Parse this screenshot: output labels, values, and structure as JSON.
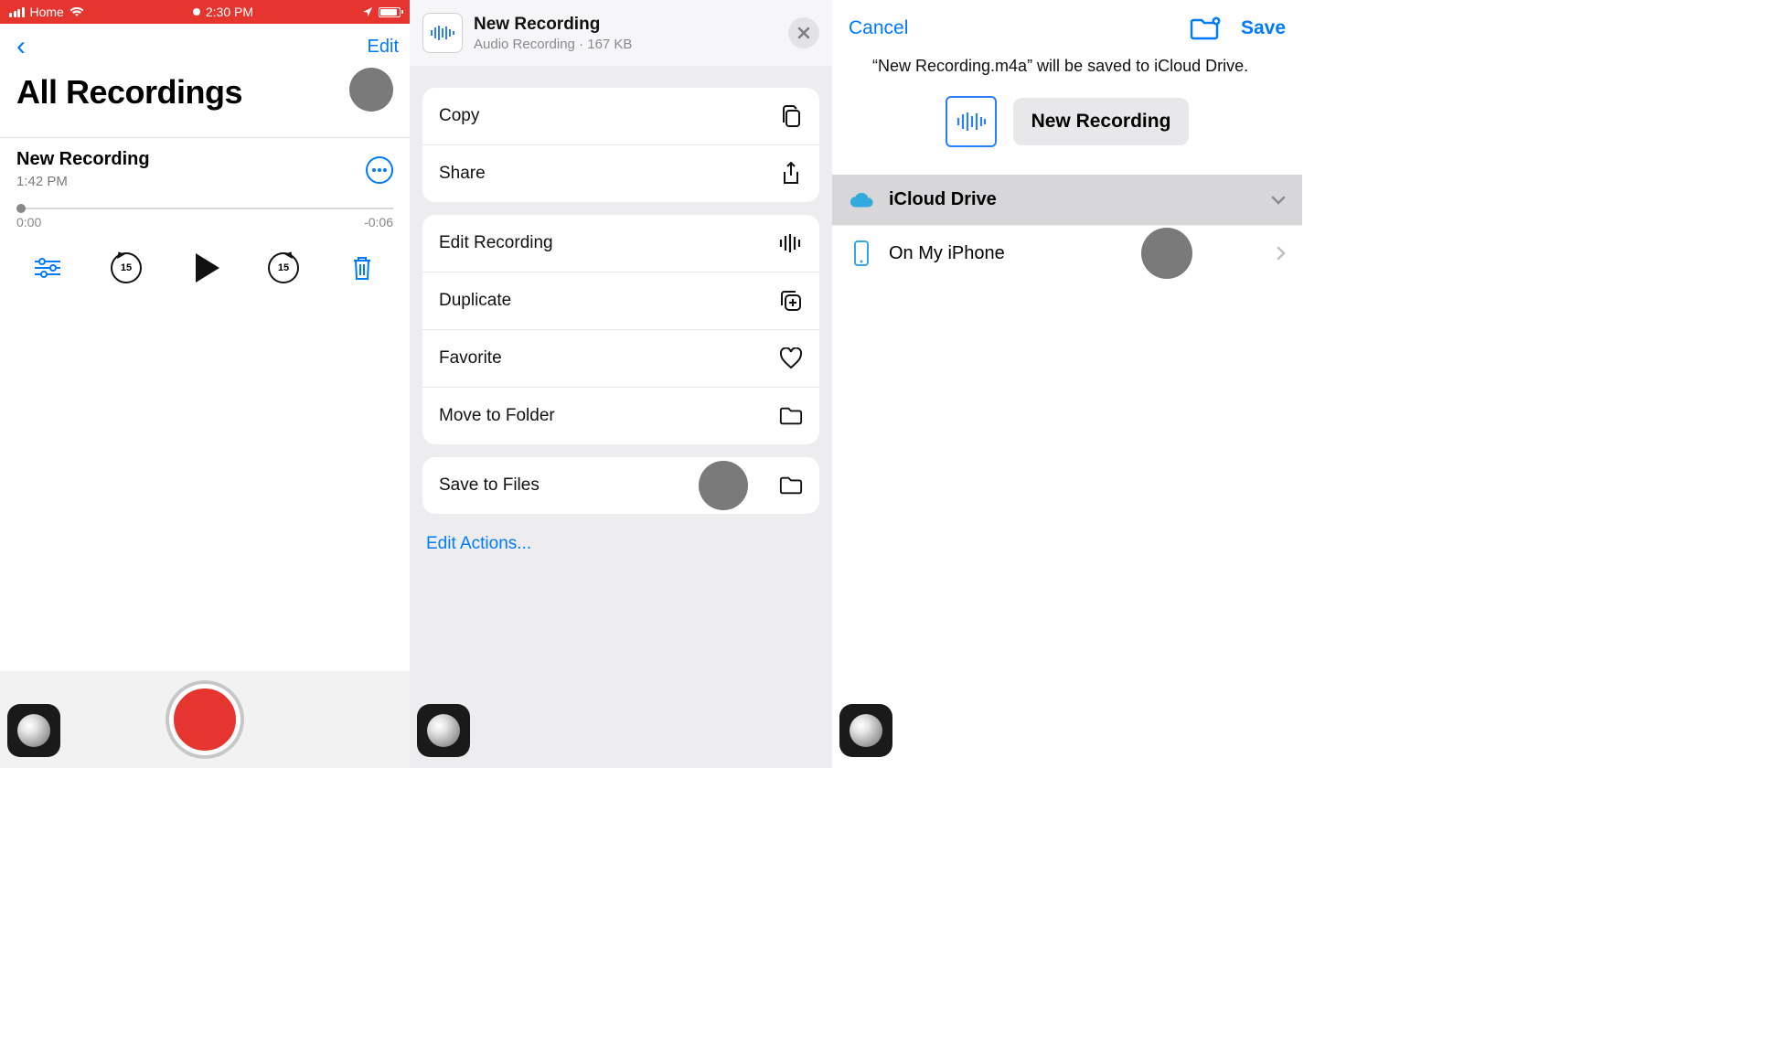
{
  "panel1": {
    "status": {
      "carrier": "Home",
      "time": "2:30 PM"
    },
    "edit": "Edit",
    "title": "All Recordings",
    "recording": {
      "name": "New Recording",
      "time": "1:42 PM",
      "elapsed": "0:00",
      "remaining": "-0:06",
      "skip": "15"
    }
  },
  "panel2": {
    "header": {
      "title": "New Recording",
      "subtitle": "Audio Recording · 167 KB"
    },
    "actions": {
      "copy": "Copy",
      "share": "Share",
      "edit": "Edit Recording",
      "duplicate": "Duplicate",
      "favorite": "Favorite",
      "move": "Move to Folder",
      "save": "Save to Files"
    },
    "editActions": "Edit Actions..."
  },
  "panel3": {
    "cancel": "Cancel",
    "save": "Save",
    "description": "“New Recording.m4a” will be saved to iCloud Drive.",
    "fileName": "New Recording",
    "locations": {
      "icloud": "iCloud Drive",
      "iphone": "On My iPhone"
    }
  }
}
